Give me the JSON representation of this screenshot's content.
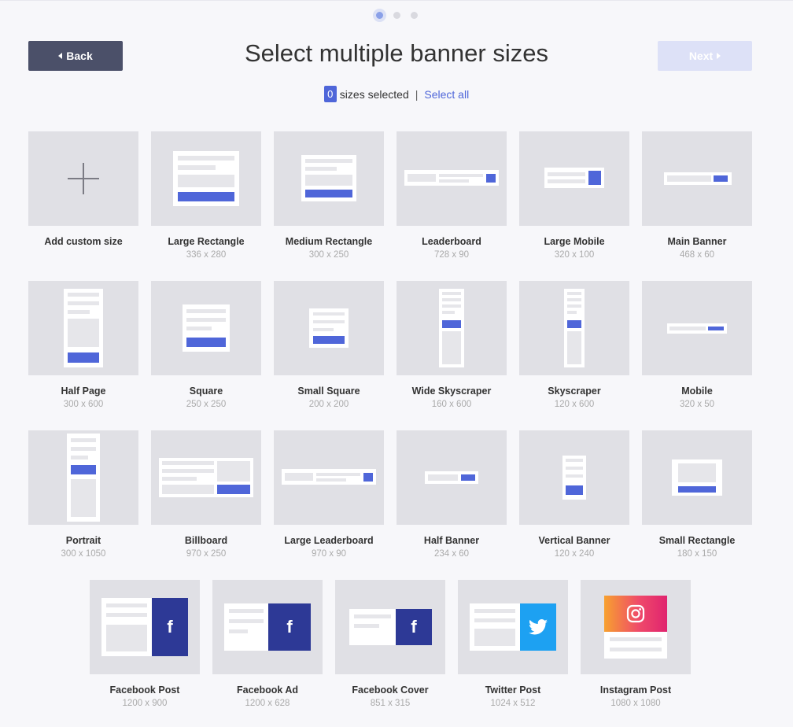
{
  "header": {
    "title": "Select multiple banner sizes",
    "back_label": "Back",
    "next_label": "Next"
  },
  "stepper": {
    "steps": 3,
    "active": 1
  },
  "selection": {
    "count": "0",
    "text": "sizes selected",
    "separator": "|",
    "select_all": "Select all"
  },
  "colors": {
    "accent": "#4f66d9",
    "back_button": "#4b5069",
    "next_button_disabled": "#dde1f7",
    "facebook": "#2d3996",
    "twitter": "#1da1f2"
  },
  "sizes": [
    {
      "label": "Add custom size",
      "dim": ""
    },
    {
      "label": "Large Rectangle",
      "dim": "336 x 280"
    },
    {
      "label": "Medium Rectangle",
      "dim": "300 x 250"
    },
    {
      "label": "Leaderboard",
      "dim": "728 x 90"
    },
    {
      "label": "Large Mobile",
      "dim": "320 x 100"
    },
    {
      "label": "Main Banner",
      "dim": "468 x 60"
    },
    {
      "label": "Half Page",
      "dim": "300 x 600"
    },
    {
      "label": "Square",
      "dim": "250 x 250"
    },
    {
      "label": "Small Square",
      "dim": "200 x 200"
    },
    {
      "label": "Wide Skyscraper",
      "dim": "160 x 600"
    },
    {
      "label": "Skyscraper",
      "dim": "120 x 600"
    },
    {
      "label": "Mobile",
      "dim": "320 x 50"
    },
    {
      "label": "Portrait",
      "dim": "300 x 1050"
    },
    {
      "label": "Billboard",
      "dim": "970 x 250"
    },
    {
      "label": "Large Leaderboard",
      "dim": "970 x 90"
    },
    {
      "label": "Half Banner",
      "dim": "234 x 60"
    },
    {
      "label": "Vertical Banner",
      "dim": "120 x 240"
    },
    {
      "label": "Small Rectangle",
      "dim": "180 x 150"
    },
    {
      "label": "Facebook Post",
      "dim": "1200 x 900",
      "icon": "facebook-icon"
    },
    {
      "label": "Facebook Ad",
      "dim": "1200 x 628",
      "icon": "facebook-icon"
    },
    {
      "label": "Facebook Cover",
      "dim": "851 x 315",
      "icon": "facebook-icon"
    },
    {
      "label": "Twitter Post",
      "dim": "1024 x 512",
      "icon": "twitter-icon"
    },
    {
      "label": "Instagram Post",
      "dim": "1080 x 1080",
      "icon": "instagram-icon"
    }
  ]
}
